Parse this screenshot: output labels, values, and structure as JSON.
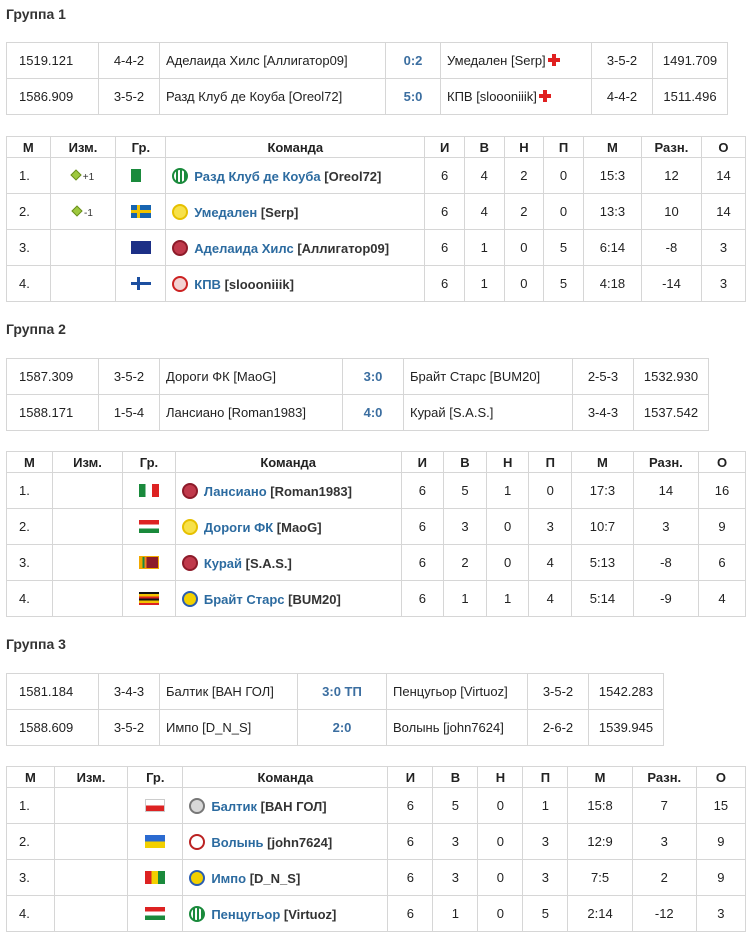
{
  "groups": [
    {
      "title": "Группа 1",
      "matches": [
        {
          "rating1": "1519.121",
          "form1": "4-4-2",
          "team1": "Аделаида Хилс [Аллигатор09]",
          "score": "0:2",
          "team2": "Умедален [Serp]",
          "red2": true,
          "form2": "3-5-2",
          "rating2": "1491.709"
        },
        {
          "rating1": "1586.909",
          "form1": "3-5-2",
          "team1": "Разд Клуб де Коуба [Oreol72]",
          "score": "5:0",
          "team2": "КПВ [slooоniiik]",
          "red2": true,
          "form2": "4-4-2",
          "rating2": "1511.496"
        }
      ],
      "rows": [
        {
          "pos": "1.",
          "change": "+1",
          "flag": "algeria",
          "logo": "green",
          "name": "Разд Клуб де Коуба",
          "user": "[Oreol72]",
          "i": "6",
          "w": "4",
          "d": "2",
          "l": "0",
          "goals": "15:3",
          "diff": "12",
          "pts": "14"
        },
        {
          "pos": "2.",
          "change": "-1",
          "flag": "sweden",
          "logo": "yellow",
          "name": "Умедален",
          "user": "[Serp]",
          "i": "6",
          "w": "4",
          "d": "2",
          "l": "0",
          "goals": "13:3",
          "diff": "10",
          "pts": "14"
        },
        {
          "pos": "3.",
          "change": "",
          "flag": "australia",
          "logo": "maroon",
          "name": "Аделаида Хилс",
          "user": "[Аллигатор09]",
          "i": "6",
          "w": "1",
          "d": "0",
          "l": "5",
          "goals": "6:14",
          "diff": "-8",
          "pts": "3"
        },
        {
          "pos": "4.",
          "change": "",
          "flag": "finland",
          "logo": "red",
          "name": "КПВ",
          "user": "[slooоniiik]",
          "i": "6",
          "w": "1",
          "d": "0",
          "l": "5",
          "goals": "4:18",
          "diff": "-14",
          "pts": "3"
        }
      ]
    },
    {
      "title": "Группа 2",
      "matches": [
        {
          "rating1": "1587.309",
          "form1": "3-5-2",
          "team1": "Дороги ФК [MaoG]",
          "score": "3:0",
          "team2": "Брайт Старс [BUM20]",
          "red2": false,
          "form2": "2-5-3",
          "rating2": "1532.930"
        },
        {
          "rating1": "1588.171",
          "form1": "1-5-4",
          "team1": "Лансиано [Roman1983]",
          "score": "4:0",
          "team2": "Курай [S.A.S.]",
          "red2": false,
          "form2": "3-4-3",
          "rating2": "1537.542"
        }
      ],
      "rows": [
        {
          "pos": "1.",
          "change": "",
          "flag": "italy",
          "logo": "maroon",
          "name": "Лансиано",
          "user": "[Roman1983]",
          "i": "6",
          "w": "5",
          "d": "1",
          "l": "0",
          "goals": "17:3",
          "diff": "14",
          "pts": "16"
        },
        {
          "pos": "2.",
          "change": "",
          "flag": "hungary",
          "logo": "yellow",
          "name": "Дороги ФК",
          "user": "[MaoG]",
          "i": "6",
          "w": "3",
          "d": "0",
          "l": "3",
          "goals": "10:7",
          "diff": "3",
          "pts": "9"
        },
        {
          "pos": "3.",
          "change": "",
          "flag": "srilanka",
          "logo": "maroon",
          "name": "Курай",
          "user": "[S.A.S.]",
          "i": "6",
          "w": "2",
          "d": "0",
          "l": "4",
          "goals": "5:13",
          "diff": "-8",
          "pts": "6"
        },
        {
          "pos": "4.",
          "change": "",
          "flag": "uganda",
          "logo": "blue",
          "name": "Брайт Старс",
          "user": "[BUM20]",
          "i": "6",
          "w": "1",
          "d": "1",
          "l": "4",
          "goals": "5:14",
          "diff": "-9",
          "pts": "4"
        }
      ]
    },
    {
      "title": "Группа 3",
      "matches": [
        {
          "rating1": "1581.184",
          "form1": "3-4-3",
          "team1": "Балтик [ВАН ГОЛ]",
          "score": "3:0 ТП",
          "team2": "Пенцугьор [Virtuoz]",
          "red2": false,
          "form2": "3-5-2",
          "rating2": "1542.283"
        },
        {
          "rating1": "1588.609",
          "form1": "3-5-2",
          "team1": "Импо [D_N_S]",
          "score": "2:0",
          "team2": "Волынь [john7624]",
          "red2": false,
          "form2": "2-6-2",
          "rating2": "1539.945"
        }
      ],
      "rows": [
        {
          "pos": "1.",
          "change": "",
          "flag": "poland",
          "logo": "grey",
          "name": "Балтик",
          "user": "[ВАН ГОЛ]",
          "i": "6",
          "w": "5",
          "d": "0",
          "l": "1",
          "goals": "15:8",
          "diff": "7",
          "pts": "15"
        },
        {
          "pos": "2.",
          "change": "",
          "flag": "ukraine",
          "logo": "redwhite",
          "name": "Волынь",
          "user": "[john7624]",
          "i": "6",
          "w": "3",
          "d": "0",
          "l": "3",
          "goals": "12:9",
          "diff": "3",
          "pts": "9"
        },
        {
          "pos": "3.",
          "change": "",
          "flag": "guinea",
          "logo": "blue",
          "name": "Импо",
          "user": "[D_N_S]",
          "i": "6",
          "w": "3",
          "d": "0",
          "l": "3",
          "goals": "7:5",
          "diff": "2",
          "pts": "9"
        },
        {
          "pos": "4.",
          "change": "",
          "flag": "hungary",
          "logo": "green",
          "name": "Пенцугьор",
          "user": "[Virtuoz]",
          "i": "6",
          "w": "1",
          "d": "0",
          "l": "5",
          "goals": "2:14",
          "diff": "-12",
          "pts": "3"
        }
      ]
    }
  ],
  "headers": {
    "m": "М",
    "change": "Изм.",
    "flag": "Гр.",
    "team": "Команда",
    "i": "И",
    "w": "В",
    "d": "Н",
    "l": "П",
    "goals": "М",
    "diff": "Разн.",
    "pts": "О"
  },
  "colors": {
    "link": "#2c6ba0",
    "border": "#d6d6d6",
    "red_card": "#e02020"
  }
}
